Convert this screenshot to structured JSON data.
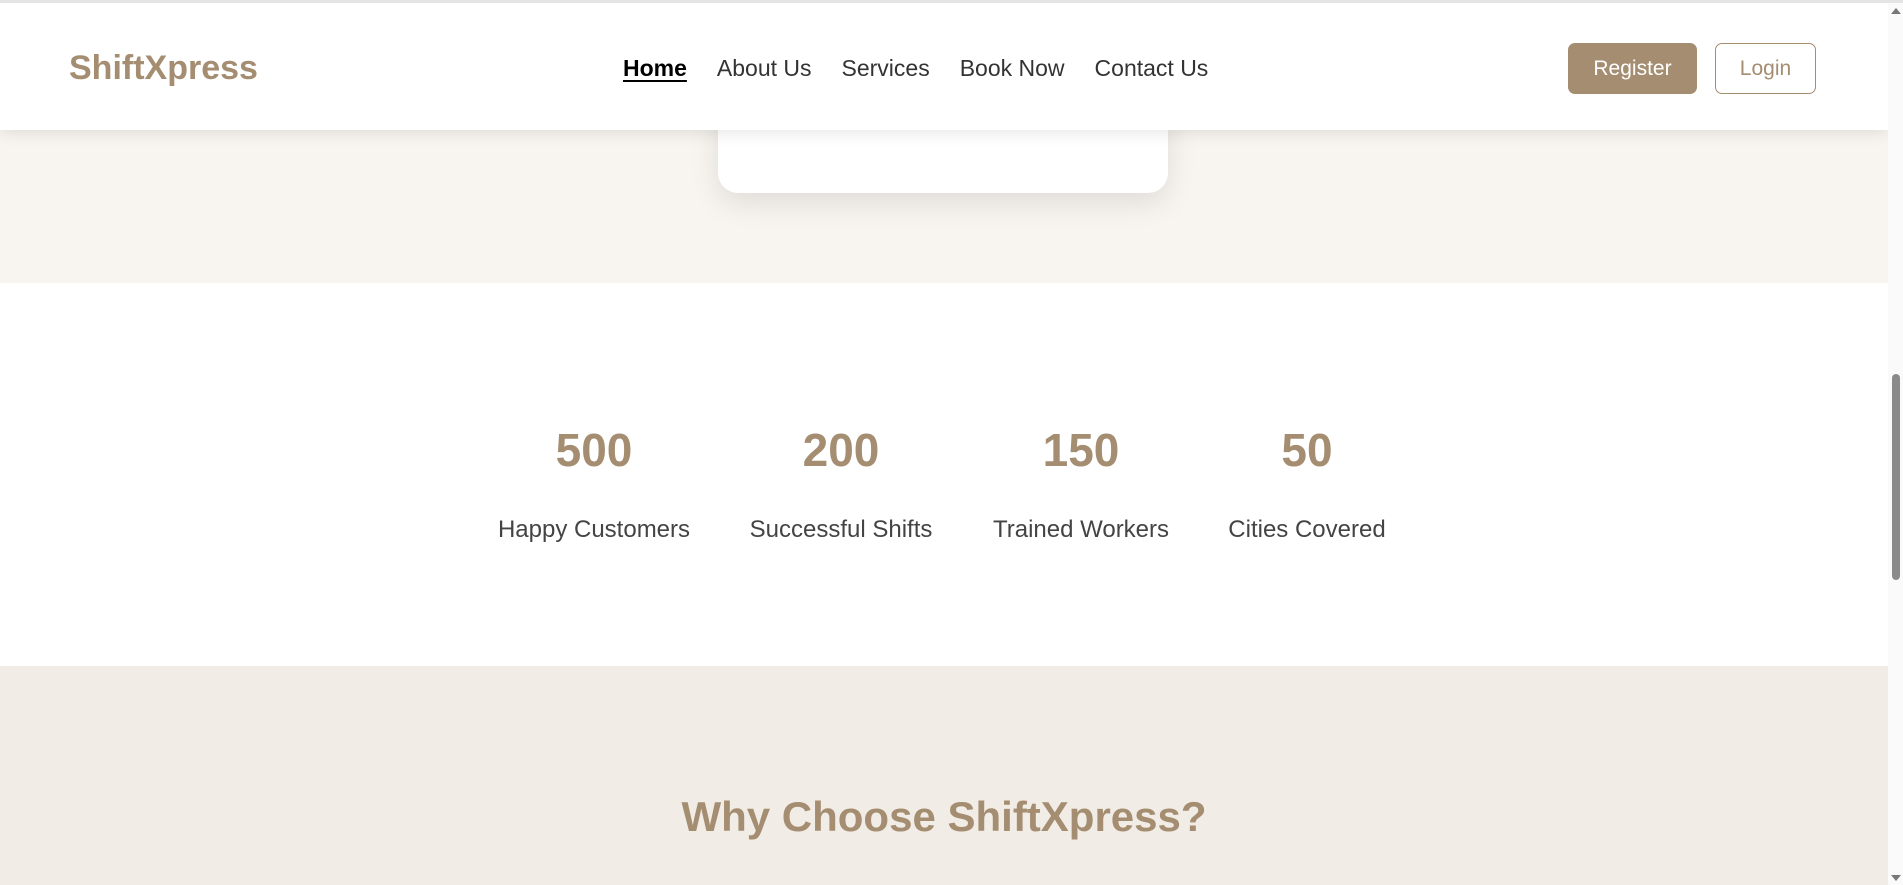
{
  "header": {
    "logo": "ShiftXpress",
    "nav": [
      {
        "label": "Home",
        "active": true
      },
      {
        "label": "About Us"
      },
      {
        "label": "Services"
      },
      {
        "label": "Book Now"
      },
      {
        "label": "Contact Us"
      }
    ],
    "register_label": "Register",
    "login_label": "Login"
  },
  "stats": [
    {
      "value": "500",
      "label": "Happy Customers"
    },
    {
      "value": "200",
      "label": "Successful Shifts"
    },
    {
      "value": "150",
      "label": "Trained Workers"
    },
    {
      "value": "50",
      "label": "Cities Covered"
    }
  ],
  "why": {
    "heading": "Why Choose ShiftXpress?"
  },
  "colors": {
    "brand": "#a48d70",
    "hero_bg": "#f8f5f0",
    "why_bg": "#f1ece6"
  }
}
